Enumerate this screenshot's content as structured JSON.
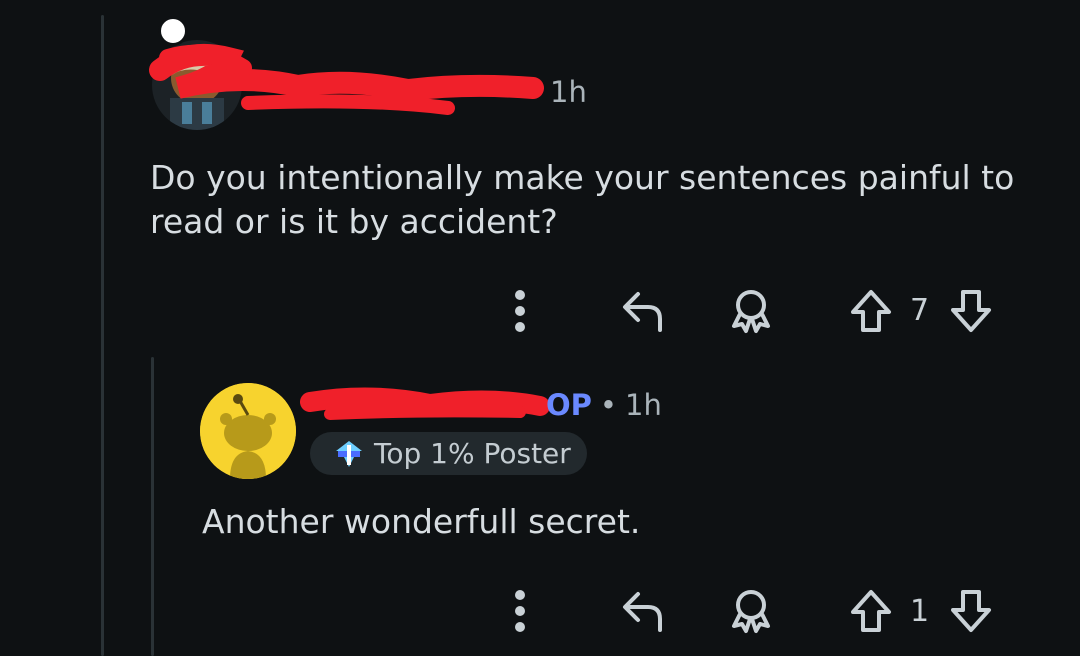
{
  "comments": [
    {
      "time": "1h",
      "body": "Do you intentionally make your sentences painful to read or is it by accident?",
      "votes": "7",
      "icons": {
        "more": "more-vertical-icon",
        "reply": "reply-icon",
        "award": "award-icon",
        "upvote": "upvote-arrow-icon",
        "downvote": "downvote-arrow-icon"
      }
    },
    {
      "op_badge": "OP",
      "separator": "•",
      "time": "1h",
      "flair": "Top 1% Poster",
      "body": "Another wonderfull secret.",
      "votes": "1"
    }
  ],
  "colors": {
    "background": "#0e1113",
    "redaction": "#f0202a",
    "op_badge": "#6a89ff",
    "avatar_yellow": "#f7d32e"
  }
}
